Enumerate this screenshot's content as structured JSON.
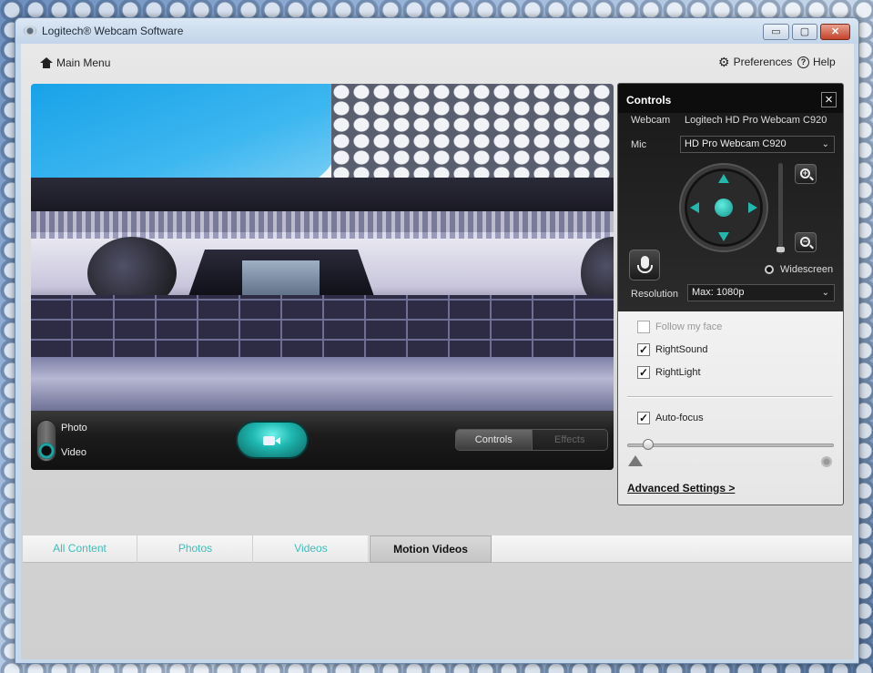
{
  "window": {
    "title": "Logitech® Webcam Software",
    "min_label": "▭",
    "max_label": "▢",
    "close_label": "✕"
  },
  "nav": {
    "main_menu": "Main Menu",
    "preferences": "Preferences",
    "help": "Help",
    "icons": {
      "home": "home-icon",
      "gear": "gear-icon",
      "help": "help-icon"
    }
  },
  "capture": {
    "photo_label": "Photo",
    "video_label": "Video",
    "mode_selected": "Video",
    "segments": {
      "controls": "Controls",
      "effects": "Effects",
      "active": "Controls"
    }
  },
  "controls": {
    "title": "Controls",
    "webcam_label": "Webcam",
    "webcam_value": "Logitech HD Pro Webcam C920",
    "mic_label": "Mic",
    "mic_value": "HD Pro Webcam C920",
    "widescreen_label": "Widescreen",
    "resolution_label": "Resolution",
    "resolution_value": "Max: 1080p",
    "options": [
      {
        "label": "Follow my face",
        "checked": false,
        "enabled": false
      },
      {
        "label": "RightSound",
        "checked": true,
        "enabled": true
      },
      {
        "label": "RightLight",
        "checked": true,
        "enabled": true
      }
    ],
    "autofocus_label": "Auto-focus",
    "autofocus_checked": true,
    "focus_level": 0.1,
    "advanced_link": "Advanced Settings >"
  },
  "tabs": [
    "All Content",
    "Photos",
    "Videos",
    "Motion Videos"
  ],
  "active_tab": "Motion Videos",
  "colors": {
    "accent": "#3cbeb9",
    "record": "#1fb9b2"
  }
}
